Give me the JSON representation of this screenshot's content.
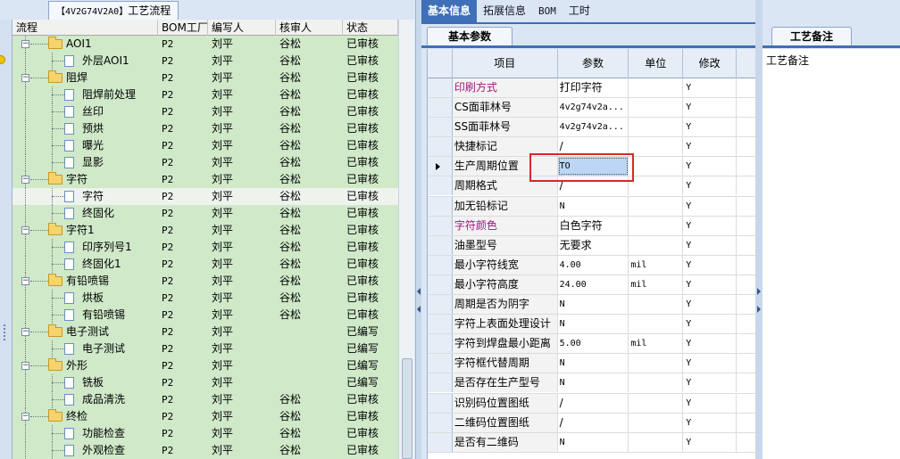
{
  "left": {
    "window_tab": {
      "code": "【4V2G74V2A0】",
      "label": "工艺流程"
    },
    "columns": [
      "流程",
      "BOM工厂",
      "编写人",
      "核审人",
      "状态"
    ],
    "rows": [
      {
        "name": "AOI1",
        "level": 0,
        "folder": true,
        "factory": "P2",
        "writer": "刘平",
        "reviewer": "谷松",
        "status": "已审核"
      },
      {
        "name": "外层AOI1",
        "level": 1,
        "folder": false,
        "factory": "P2",
        "writer": "刘平",
        "reviewer": "谷松",
        "status": "已审核"
      },
      {
        "name": "阻焊",
        "level": 0,
        "folder": true,
        "factory": "P2",
        "writer": "刘平",
        "reviewer": "谷松",
        "status": "已审核"
      },
      {
        "name": "阻焊前处理",
        "level": 1,
        "folder": false,
        "factory": "P2",
        "writer": "刘平",
        "reviewer": "谷松",
        "status": "已审核"
      },
      {
        "name": "丝印",
        "level": 1,
        "folder": false,
        "factory": "P2",
        "writer": "刘平",
        "reviewer": "谷松",
        "status": "已审核"
      },
      {
        "name": "预烘",
        "level": 1,
        "folder": false,
        "factory": "P2",
        "writer": "刘平",
        "reviewer": "谷松",
        "status": "已审核"
      },
      {
        "name": "曝光",
        "level": 1,
        "folder": false,
        "factory": "P2",
        "writer": "刘平",
        "reviewer": "谷松",
        "status": "已审核"
      },
      {
        "name": "显影",
        "level": 1,
        "folder": false,
        "factory": "P2",
        "writer": "刘平",
        "reviewer": "谷松",
        "status": "已审核"
      },
      {
        "name": "字符",
        "level": 0,
        "folder": true,
        "factory": "P2",
        "writer": "刘平",
        "reviewer": "谷松",
        "status": "已审核"
      },
      {
        "name": "字符",
        "level": 1,
        "folder": false,
        "factory": "P2",
        "writer": "刘平",
        "reviewer": "谷松",
        "status": "已审核",
        "selected": true
      },
      {
        "name": "终固化",
        "level": 1,
        "folder": false,
        "factory": "P2",
        "writer": "刘平",
        "reviewer": "谷松",
        "status": "已审核"
      },
      {
        "name": "字符1",
        "level": 0,
        "folder": true,
        "factory": "P2",
        "writer": "刘平",
        "reviewer": "谷松",
        "status": "已审核"
      },
      {
        "name": "印序列号1",
        "level": 1,
        "folder": false,
        "factory": "P2",
        "writer": "刘平",
        "reviewer": "谷松",
        "status": "已审核"
      },
      {
        "name": "终固化1",
        "level": 1,
        "folder": false,
        "factory": "P2",
        "writer": "刘平",
        "reviewer": "谷松",
        "status": "已审核"
      },
      {
        "name": "有铅喷锡",
        "level": 0,
        "folder": true,
        "factory": "P2",
        "writer": "刘平",
        "reviewer": "谷松",
        "status": "已审核"
      },
      {
        "name": "烘板",
        "level": 1,
        "folder": false,
        "factory": "P2",
        "writer": "刘平",
        "reviewer": "谷松",
        "status": "已审核"
      },
      {
        "name": "有铅喷锡",
        "level": 1,
        "folder": false,
        "factory": "P2",
        "writer": "刘平",
        "reviewer": "谷松",
        "status": "已审核"
      },
      {
        "name": "电子测试",
        "level": 0,
        "folder": true,
        "factory": "P2",
        "writer": "刘平",
        "reviewer": "",
        "status": "已编写"
      },
      {
        "name": "电子测试",
        "level": 1,
        "folder": false,
        "factory": "P2",
        "writer": "刘平",
        "reviewer": "",
        "status": "已编写"
      },
      {
        "name": "外形",
        "level": 0,
        "folder": true,
        "factory": "P2",
        "writer": "刘平",
        "reviewer": "",
        "status": "已编写"
      },
      {
        "name": "铣板",
        "level": 1,
        "folder": false,
        "factory": "P2",
        "writer": "刘平",
        "reviewer": "",
        "status": "已编写"
      },
      {
        "name": "成品清洗",
        "level": 1,
        "folder": false,
        "factory": "P2",
        "writer": "刘平",
        "reviewer": "谷松",
        "status": "已审核"
      },
      {
        "name": "终检",
        "level": 0,
        "folder": true,
        "factory": "P2",
        "writer": "刘平",
        "reviewer": "谷松",
        "status": "已审核"
      },
      {
        "name": "功能检查",
        "level": 1,
        "folder": false,
        "factory": "P2",
        "writer": "刘平",
        "reviewer": "谷松",
        "status": "已审核"
      },
      {
        "name": "外观检查",
        "level": 1,
        "folder": false,
        "factory": "P2",
        "writer": "刘平",
        "reviewer": "谷松",
        "status": "已审核"
      }
    ]
  },
  "middle": {
    "tabs": [
      "基本信息",
      "拓展信息",
      "BOM",
      "工时"
    ],
    "active_tab": 0,
    "sub_tab": "基本参数",
    "columns": [
      "项目",
      "参数",
      "单位",
      "修改"
    ],
    "rows": [
      {
        "item": "印刷方式",
        "param": "打印字符",
        "unit": "",
        "modify": "Y",
        "magenta": true
      },
      {
        "item": "CS面菲林号",
        "param": "4v2g74v2a...",
        "unit": "",
        "modify": "Y",
        "mono": true
      },
      {
        "item": "SS面菲林号",
        "param": "4v2g74v2a...",
        "unit": "",
        "modify": "Y",
        "mono": true
      },
      {
        "item": "快捷标记",
        "param": "/",
        "unit": "",
        "modify": "Y"
      },
      {
        "item": "生产周期位置",
        "param": "TO",
        "unit": "",
        "modify": "Y",
        "current": true,
        "mono": true
      },
      {
        "item": "周期格式",
        "param": "/",
        "unit": "",
        "modify": "Y"
      },
      {
        "item": "加无铅标记",
        "param": "N",
        "unit": "",
        "modify": "Y",
        "mono": true
      },
      {
        "item": "字符颜色",
        "param": "白色字符",
        "unit": "",
        "modify": "Y",
        "magenta": true
      },
      {
        "item": "油墨型号",
        "param": "无要求",
        "unit": "",
        "modify": "Y"
      },
      {
        "item": "最小字符线宽",
        "param": "4.00",
        "unit": "mil",
        "modify": "Y",
        "mono": true
      },
      {
        "item": "最小字符高度",
        "param": "24.00",
        "unit": "mil",
        "modify": "Y",
        "mono": true
      },
      {
        "item": "周期是否为阴字",
        "param": "N",
        "unit": "",
        "modify": "Y",
        "mono": true
      },
      {
        "item": "字符上表面处理设计",
        "param": "N",
        "unit": "",
        "modify": "Y",
        "mono": true
      },
      {
        "item": "字符到焊盘最小距离",
        "param": "5.00",
        "unit": "mil",
        "modify": "Y",
        "mono": true
      },
      {
        "item": "字符框代替周期",
        "param": "N",
        "unit": "",
        "modify": "Y",
        "mono": true
      },
      {
        "item": "是否存在生产型号",
        "param": "N",
        "unit": "",
        "modify": "Y",
        "mono": true
      },
      {
        "item": "识别码位置图纸",
        "param": "/",
        "unit": "",
        "modify": "Y"
      },
      {
        "item": "二维码位置图纸",
        "param": "/",
        "unit": "",
        "modify": "Y"
      },
      {
        "item": "是否有二维码",
        "param": "N",
        "unit": "",
        "modify": "Y",
        "mono": true
      }
    ]
  },
  "right": {
    "tab": "工艺备注",
    "label": "工艺备注"
  }
}
